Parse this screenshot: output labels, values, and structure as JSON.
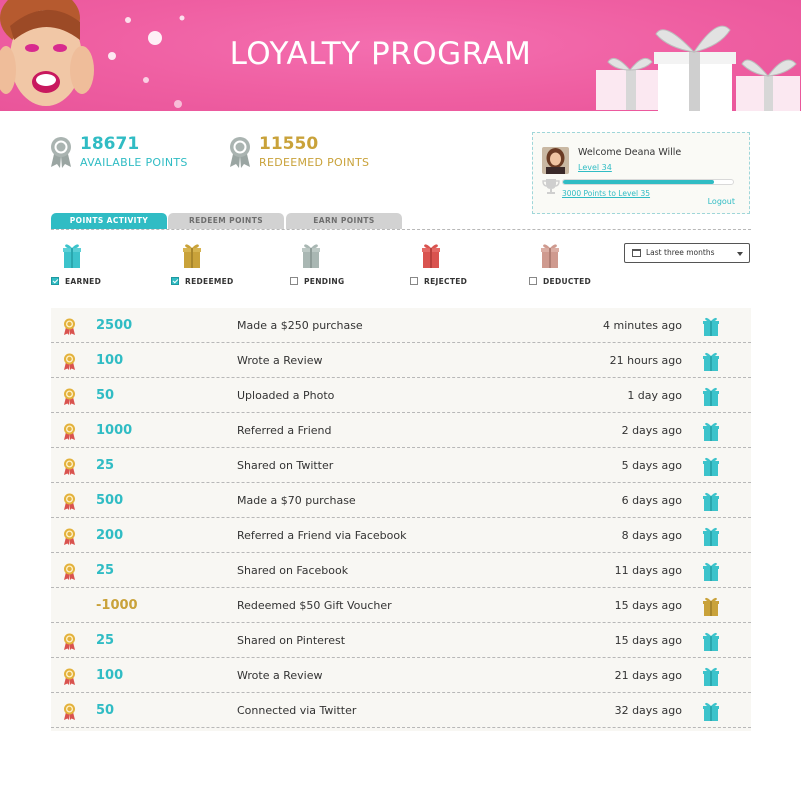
{
  "banner": {
    "title": "LOYALTY PROGRAM"
  },
  "stats": {
    "available": {
      "value": "18671",
      "label": "AVAILABLE POINTS"
    },
    "redeemed": {
      "value": "11550",
      "label": "REDEEMED POINTS"
    }
  },
  "user": {
    "welcome": "Welcome Deana Wille",
    "level": "Level 34",
    "progress_fraction": 0.89,
    "to_next_level": "3000 Points to Level 35",
    "logout": "Logout"
  },
  "tabs": [
    {
      "label": "POINTS ACTIVITY",
      "active": true
    },
    {
      "label": "REDEEM POINTS",
      "active": false
    },
    {
      "label": "EARN POINTS",
      "active": false
    }
  ],
  "filters": [
    {
      "label": "EARNED",
      "checked": true,
      "color": "#3cc3cb"
    },
    {
      "label": "REDEEMED",
      "checked": true,
      "color": "#c9a23a"
    },
    {
      "label": "PENDING",
      "checked": false,
      "color": "#a9b7b3"
    },
    {
      "label": "REJECTED",
      "checked": false,
      "color": "#d9534f"
    },
    {
      "label": "DEDUCTED",
      "checked": false,
      "color": "#cf9a8f"
    }
  ],
  "period_select": {
    "value": "Last three months"
  },
  "colors": {
    "accent": "#30bcc4",
    "gold": "#c9a23a",
    "banner": "#ef5fa2"
  },
  "activities": [
    {
      "points": "2500",
      "description": "Made a $250 purchase",
      "time": "4 minutes ago",
      "type": "earned"
    },
    {
      "points": "100",
      "description": "Wrote a Review",
      "time": "21 hours ago",
      "type": "earned"
    },
    {
      "points": "50",
      "description": "Uploaded a Photo",
      "time": "1 day ago",
      "type": "earned"
    },
    {
      "points": "1000",
      "description": "Referred a Friend",
      "time": "2 days ago",
      "type": "earned"
    },
    {
      "points": "25",
      "description": "Shared on Twitter",
      "time": "5 days ago",
      "type": "earned"
    },
    {
      "points": "500",
      "description": "Made a $70 purchase",
      "time": "6 days ago",
      "type": "earned"
    },
    {
      "points": "200",
      "description": "Referred a Friend via Facebook",
      "time": "8 days ago",
      "type": "earned"
    },
    {
      "points": "25",
      "description": "Shared on Facebook",
      "time": "11 days ago",
      "type": "earned"
    },
    {
      "points": "-1000",
      "description": "Redeemed $50 Gift Voucher",
      "time": "15 days ago",
      "type": "redeemed"
    },
    {
      "points": "25",
      "description": "Shared on Pinterest",
      "time": "15 days ago",
      "type": "earned"
    },
    {
      "points": "100",
      "description": "Wrote a Review",
      "time": "21 days ago",
      "type": "earned"
    },
    {
      "points": "50",
      "description": "Connected via Twitter",
      "time": "32 days ago",
      "type": "earned"
    }
  ]
}
